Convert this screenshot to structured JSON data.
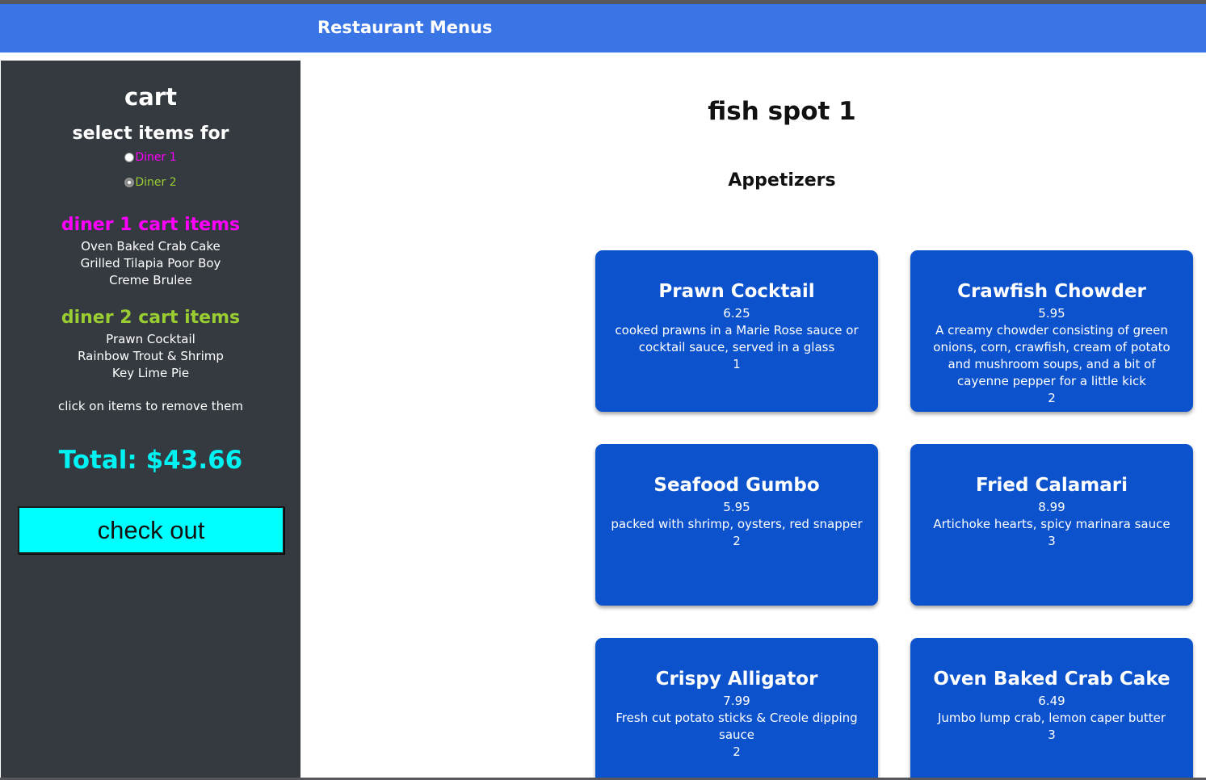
{
  "header": {
    "title": "Restaurant Menus"
  },
  "sidebar": {
    "cart_title": "cart",
    "select_title": "select items for",
    "diners": [
      {
        "label": "Diner 1",
        "color": "#ff00ff"
      },
      {
        "label": "Diner 2",
        "color": "#9acd32"
      }
    ],
    "diner1_heading": "diner 1 cart items",
    "diner1_items": [
      "Oven Baked Crab Cake",
      "Grilled Tilapia Poor Boy",
      "Creme Brulee"
    ],
    "diner2_heading": "diner 2 cart items",
    "diner2_items": [
      "Prawn Cocktail",
      "Rainbow Trout & Shrimp",
      "Key Lime Pie"
    ],
    "hint": "click on items to remove them",
    "total": "Total: $43.66",
    "checkout_label": "check out"
  },
  "main": {
    "restaurant": "fish spot 1",
    "section": "Appetizers",
    "items": [
      {
        "name": "Prawn Cocktail",
        "price": "6.25",
        "description": "cooked prawns in a Marie Rose sauce or cocktail sauce, served in a glass",
        "qty": "1"
      },
      {
        "name": "Crawfish Chowder",
        "price": "5.95",
        "description": "A creamy chowder consisting of green onions, corn, crawfish, cream of potato and mushroom soups, and a bit of cayenne pepper for a little kick",
        "qty": "2"
      },
      {
        "name": "Seafood Gumbo",
        "price": "5.95",
        "description": "packed with shrimp, oysters, red snapper",
        "qty": "2"
      },
      {
        "name": "Fried Calamari",
        "price": "8.99",
        "description": "Artichoke hearts, spicy marinara sauce",
        "qty": "3"
      },
      {
        "name": "Crispy Alligator",
        "price": "7.99",
        "description": "Fresh cut potato sticks & Creole dipping sauce",
        "qty": "2"
      },
      {
        "name": "Oven Baked Crab Cake",
        "price": "6.49",
        "description": "Jumbo lump crab, lemon caper butter",
        "qty": "3"
      }
    ]
  }
}
